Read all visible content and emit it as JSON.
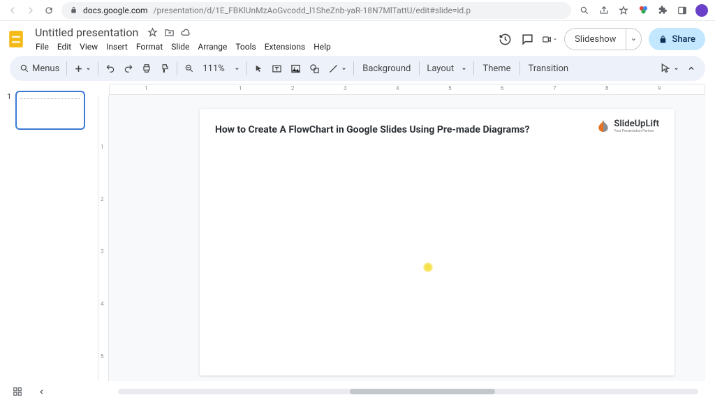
{
  "browser": {
    "host": "docs.google.com",
    "path": "/presentation/d/1E_FBKlUnMzAoGvcodd_l1SheZnb-yaR-18N7MlTattU/edit#slide=id.p"
  },
  "doc": {
    "title": "Untitled presentation"
  },
  "menu": {
    "file": "File",
    "edit": "Edit",
    "view": "View",
    "insert": "Insert",
    "format": "Format",
    "slide": "Slide",
    "arrange": "Arrange",
    "tools": "Tools",
    "extensions": "Extensions",
    "help": "Help"
  },
  "actions": {
    "slideshow": "Slideshow",
    "share": "Share"
  },
  "toolbar": {
    "menus": "Menus",
    "zoom": "111%",
    "background": "Background",
    "layout": "Layout",
    "theme": "Theme",
    "transition": "Transition"
  },
  "panel": {
    "slide_index": "1"
  },
  "ruler_h": [
    "1",
    "",
    "1",
    "2",
    "3",
    "4",
    "5",
    "6",
    "7",
    "8",
    "9"
  ],
  "ruler_v": [
    "1",
    "",
    "1",
    "2",
    "3",
    "4",
    "5"
  ],
  "slide": {
    "title": "How to Create A FlowChart in Google Slides Using Pre-made Diagrams?",
    "logo": "SlideUpLift",
    "logo_sub": "Your Presentation Partner"
  }
}
